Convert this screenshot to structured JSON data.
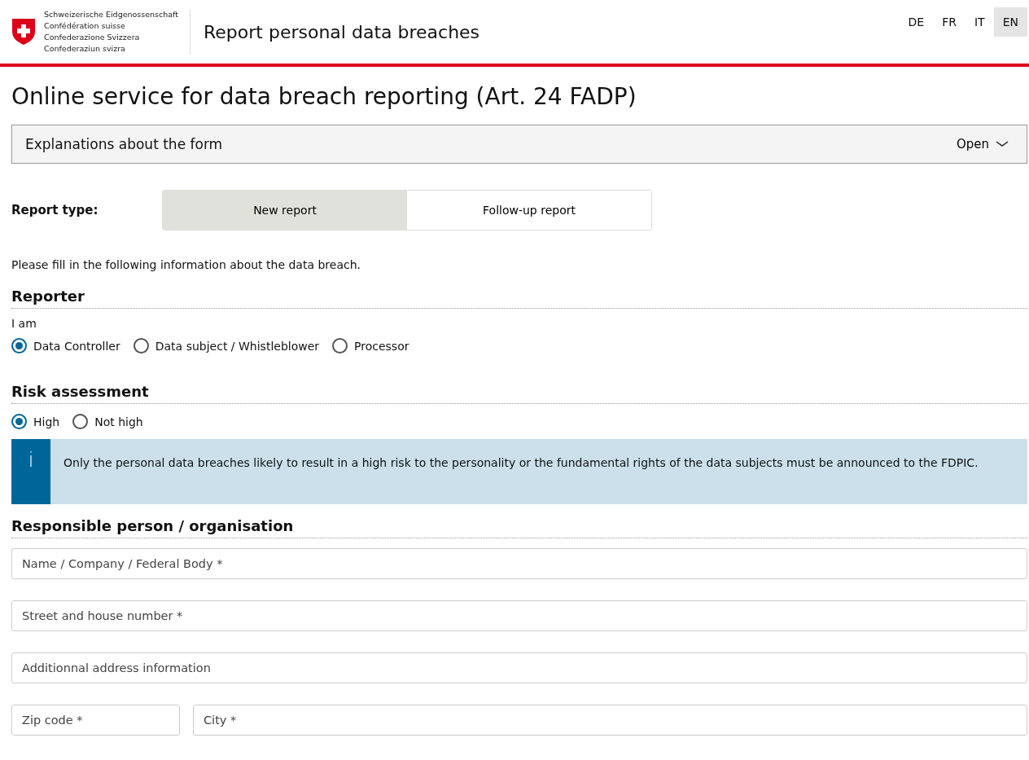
{
  "header": {
    "logo_lines": [
      "Schweizerische Eidgenossenschaft",
      "Confédération suisse",
      "Confederazione Svizzera",
      "Confederaziun svizra"
    ],
    "site_title": "Report personal data breaches",
    "languages": [
      {
        "label": "DE",
        "selected": false
      },
      {
        "label": "FR",
        "selected": false
      },
      {
        "label": "IT",
        "selected": false
      },
      {
        "label": "EN",
        "selected": true
      }
    ]
  },
  "page_title": "Online service for data breach reporting (Art. 24 FADP)",
  "accordion": {
    "title": "Explanations about the form",
    "toggle": "Open",
    "expanded": false
  },
  "report_type": {
    "label": "Report type:",
    "options": [
      {
        "label": "New report",
        "selected": true
      },
      {
        "label": "Follow-up report",
        "selected": false
      }
    ]
  },
  "intro": "Please fill in the following information about the data breach.",
  "reporter": {
    "heading": "Reporter",
    "prompt": "I am",
    "options": [
      {
        "label": "Data Controller",
        "selected": true
      },
      {
        "label": "Data subject / Whistleblower",
        "selected": false
      },
      {
        "label": "Processor",
        "selected": false
      }
    ]
  },
  "risk": {
    "heading": "Risk assessment",
    "options": [
      {
        "label": "High",
        "selected": true
      },
      {
        "label": "Not high",
        "selected": false
      }
    ],
    "info_icon": "i",
    "info": "Only the personal data breaches likely to result in a high risk to the personality or the fundamental rights of the data subjects must be announced to the FDPIC."
  },
  "responsible": {
    "heading": "Responsible person / organisation",
    "fields": [
      [
        {
          "placeholder": "Name / Company / Federal Body *"
        }
      ],
      [
        {
          "placeholder": "Street and house number *"
        }
      ],
      [
        {
          "placeholder": "Additionnal address information"
        }
      ],
      [
        {
          "placeholder": "Zip code *"
        },
        {
          "placeholder": "City *"
        }
      ]
    ]
  }
}
